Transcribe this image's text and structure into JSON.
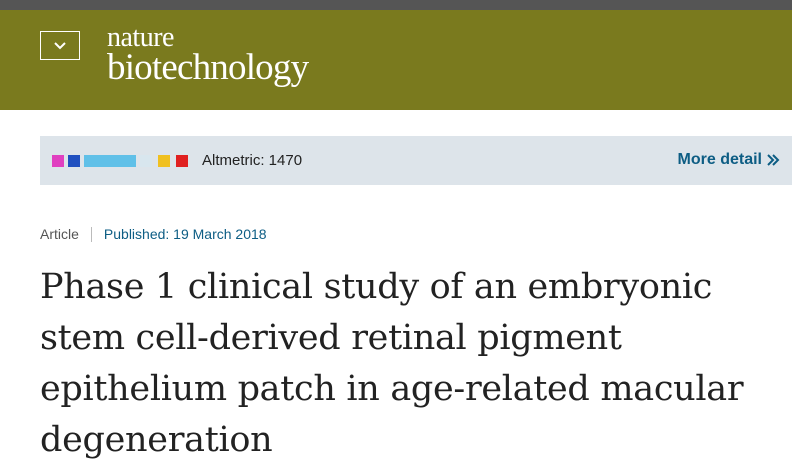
{
  "header": {
    "logo_line1": "nature",
    "logo_line2": "biotechnology",
    "menu_icon": "chevron-down-icon",
    "background_color": "#7a7a1e"
  },
  "altmetric": {
    "badge_colors": [
      "#e040c0",
      "#2050c0",
      "#60c0e8",
      "#f0c020",
      "#e02020"
    ],
    "score_text": "Altmetric: 1470",
    "more_detail_label": "More detail",
    "more_detail_icon": "double-chevron-right-icon"
  },
  "article": {
    "type": "Article",
    "published": "Published: 19 March 2018",
    "title": "Phase 1 clinical study of an embryonic stem cell-derived retinal pigment epithelium patch in age-related macular degeneration"
  }
}
